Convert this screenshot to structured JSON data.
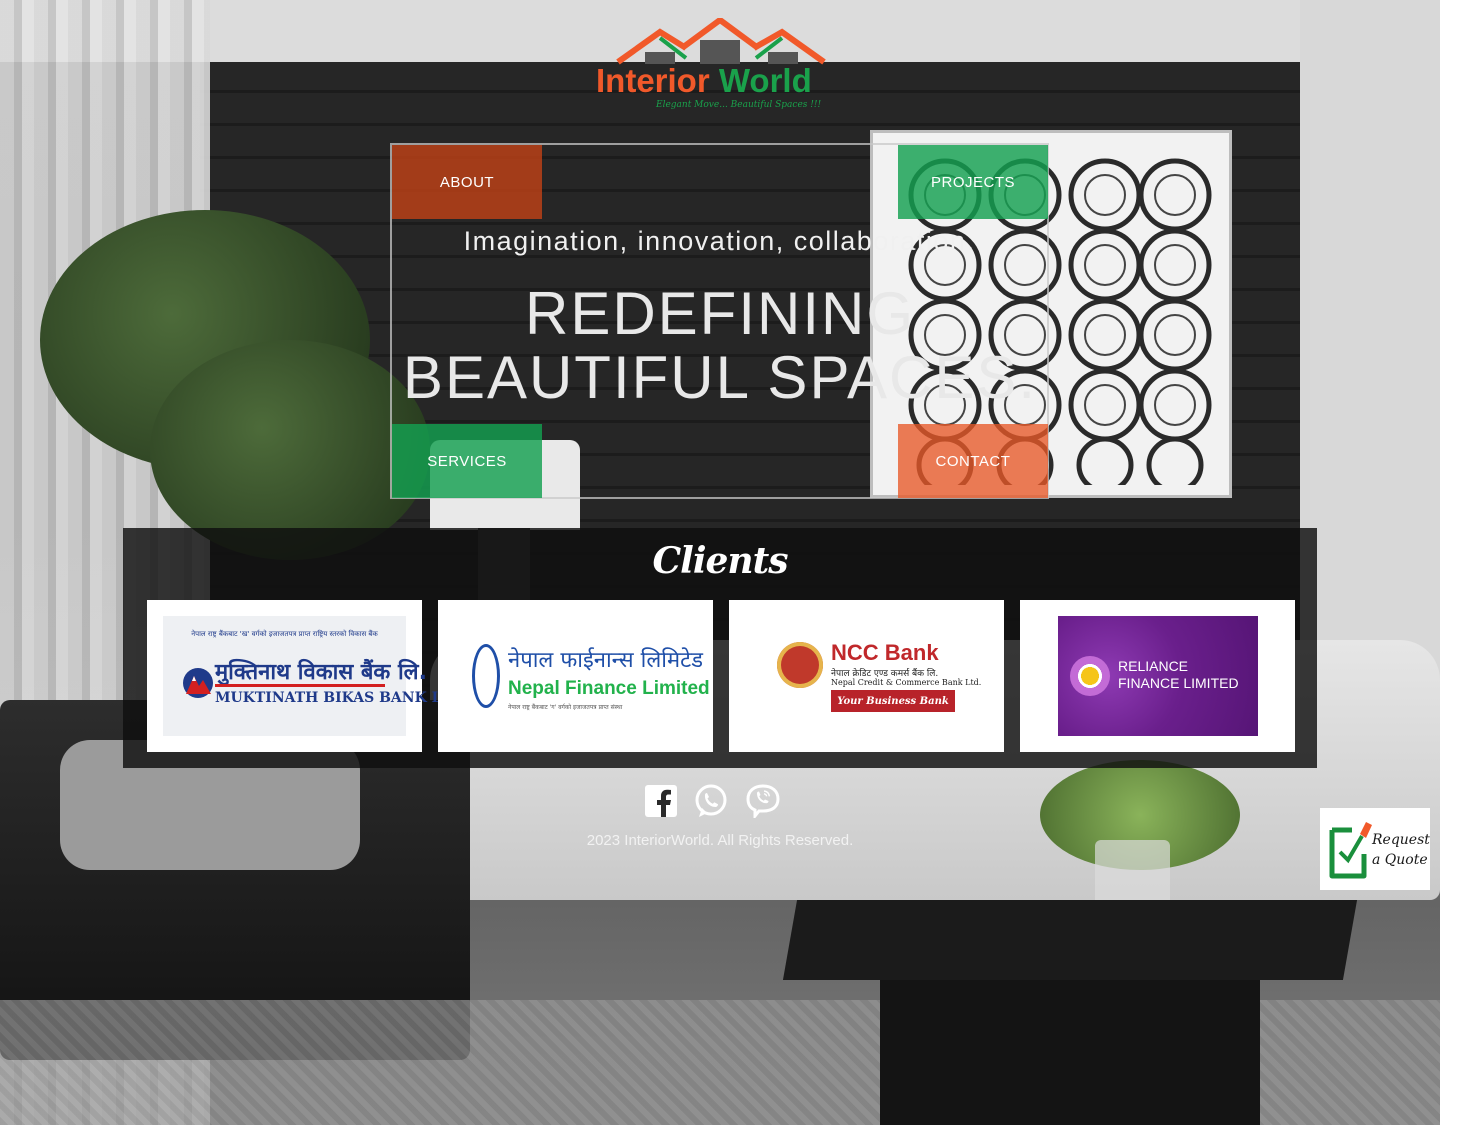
{
  "brand": {
    "name_part1": "Interior",
    "name_part2": "World",
    "tagline": "Elegant Move... Beautiful Spaces !!!",
    "orange": "#f1592a",
    "green": "#1aa14b"
  },
  "nav": {
    "about": "ABOUT",
    "projects": "PROJECTS",
    "services": "SERVICES",
    "contact": "CONTACT"
  },
  "hero": {
    "tagline": "Imagination, innovation, collaboration.",
    "headline_line1": "REDEFINING",
    "headline_line2": "BEAUTIFUL SPACES."
  },
  "clients": {
    "title": "Clients",
    "items": [
      {
        "nepali_caption": "नेपाल राष्ट्र बैंकबाट 'ख' वर्गको इजाजतपत्र प्राप्त राष्ट्रिय स्तरको विकास बैंक",
        "nepali_name": "मुक्तिनाथ विकास बैंक लि.",
        "english_name": "MUKTINATH BIKAS BANK LTD."
      },
      {
        "nepali_name": "नेपाल फाईनान्स लिमिटेड",
        "english_name": "Nepal Finance Limited",
        "caption": "नेपाल राष्ट्र बैंकबाट 'ग' वर्गको इजाजतपत्र प्राप्त संस्था"
      },
      {
        "title": "NCC Bank",
        "nepali_name": "नेपाल क्रेडिट एण्ड कमर्स बैंक लि.",
        "english_name": "Nepal Credit & Commerce Bank Ltd.",
        "slogan": "Your Business Bank"
      },
      {
        "line1": "RELIANCE",
        "line2": "FINANCE LIMITED"
      }
    ]
  },
  "social": {
    "icons": [
      "facebook-icon",
      "whatsapp-icon",
      "viber-icon"
    ]
  },
  "footer": {
    "copyright": "2023 InteriorWorld. All Rights Reserved."
  },
  "quote": {
    "line1": "Request",
    "line2": "a Quote"
  }
}
